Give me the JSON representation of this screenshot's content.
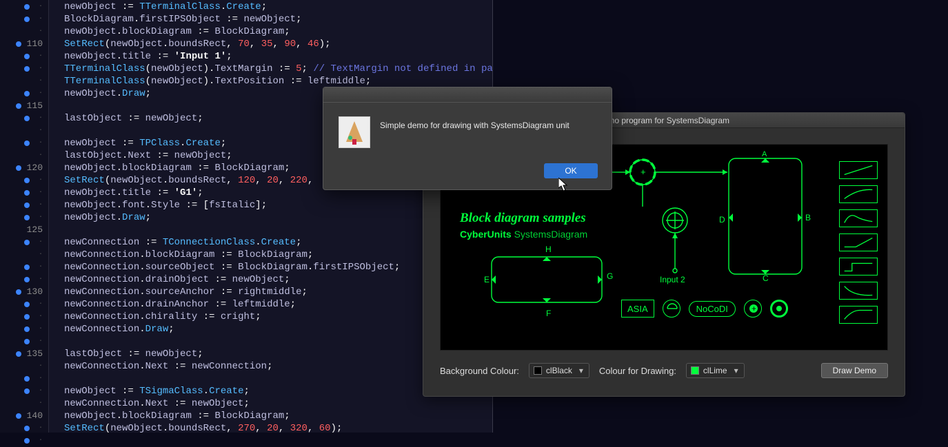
{
  "gutter": {
    "start": 107,
    "end": 142,
    "labeled": [
      110,
      115,
      120,
      125,
      130,
      135,
      140
    ],
    "breakpoints": [
      107,
      108,
      110,
      111,
      112,
      114,
      115,
      116,
      118,
      120,
      121,
      122,
      123,
      124,
      126,
      128,
      129,
      130,
      131,
      132,
      133,
      134,
      135,
      137,
      138,
      140,
      141,
      142
    ]
  },
  "code": {
    "lines": [
      [
        [
          "id",
          "newObject"
        ],
        [
          "punc",
          " := "
        ],
        [
          "type",
          "TTerminalClass"
        ],
        [
          "punc",
          "."
        ],
        [
          "func",
          "Create"
        ],
        [
          "punc",
          ";"
        ]
      ],
      [
        [
          "id",
          "BlockDiagram"
        ],
        [
          "punc",
          "."
        ],
        [
          "prop",
          "firstIPSObject"
        ],
        [
          "punc",
          " := "
        ],
        [
          "id",
          "newObject"
        ],
        [
          "punc",
          ";"
        ]
      ],
      [
        [
          "id",
          "newObject"
        ],
        [
          "punc",
          "."
        ],
        [
          "prop",
          "blockDiagram"
        ],
        [
          "punc",
          " := "
        ],
        [
          "id",
          "BlockDiagram"
        ],
        [
          "punc",
          ";"
        ]
      ],
      [
        [
          "func",
          "SetRect"
        ],
        [
          "punc",
          "("
        ],
        [
          "id",
          "newObject"
        ],
        [
          "punc",
          "."
        ],
        [
          "prop",
          "boundsRect"
        ],
        [
          "punc",
          ", "
        ],
        [
          "num",
          "70"
        ],
        [
          "punc",
          ", "
        ],
        [
          "num",
          "35"
        ],
        [
          "punc",
          ", "
        ],
        [
          "num",
          "90"
        ],
        [
          "punc",
          ", "
        ],
        [
          "num",
          "46"
        ],
        [
          "punc",
          ");"
        ]
      ],
      [
        [
          "id",
          "newObject"
        ],
        [
          "punc",
          "."
        ],
        [
          "prop",
          "title"
        ],
        [
          "punc",
          " := "
        ],
        [
          "str",
          "'Input 1'"
        ],
        [
          "punc",
          ";"
        ]
      ],
      [
        [
          "type",
          "TTerminalClass"
        ],
        [
          "punc",
          "("
        ],
        [
          "id",
          "newObject"
        ],
        [
          "punc",
          ")."
        ],
        [
          "prop",
          "TextMargin"
        ],
        [
          "punc",
          " := "
        ],
        [
          "num",
          "5"
        ],
        [
          "punc",
          "; "
        ],
        [
          "cmt",
          "// TextMargin not defined in parent class"
        ]
      ],
      [
        [
          "type",
          "TTerminalClass"
        ],
        [
          "punc",
          "("
        ],
        [
          "id",
          "newObject"
        ],
        [
          "punc",
          ")."
        ],
        [
          "prop",
          "TextPosition"
        ],
        [
          "punc",
          " := "
        ],
        [
          "const",
          "leftmiddle"
        ],
        [
          "punc",
          ";"
        ]
      ],
      [
        [
          "id",
          "newObject"
        ],
        [
          "punc",
          "."
        ],
        [
          "func",
          "Draw"
        ],
        [
          "punc",
          ";"
        ]
      ],
      [],
      [
        [
          "id",
          "lastObject"
        ],
        [
          "punc",
          " := "
        ],
        [
          "id",
          "newObject"
        ],
        [
          "punc",
          ";"
        ]
      ],
      [],
      [
        [
          "id",
          "newObject"
        ],
        [
          "punc",
          " := "
        ],
        [
          "type",
          "TPClass"
        ],
        [
          "punc",
          "."
        ],
        [
          "func",
          "Create"
        ],
        [
          "punc",
          ";"
        ]
      ],
      [
        [
          "id",
          "lastObject"
        ],
        [
          "punc",
          "."
        ],
        [
          "prop",
          "Next"
        ],
        [
          "punc",
          " := "
        ],
        [
          "id",
          "newObject"
        ],
        [
          "punc",
          ";"
        ]
      ],
      [
        [
          "id",
          "newObject"
        ],
        [
          "punc",
          "."
        ],
        [
          "prop",
          "blockDiagram"
        ],
        [
          "punc",
          " := "
        ],
        [
          "id",
          "BlockDiagram"
        ],
        [
          "punc",
          ";"
        ]
      ],
      [
        [
          "func",
          "SetRect"
        ],
        [
          "punc",
          "("
        ],
        [
          "id",
          "newObject"
        ],
        [
          "punc",
          "."
        ],
        [
          "prop",
          "boundsRect"
        ],
        [
          "punc",
          ", "
        ],
        [
          "num",
          "120"
        ],
        [
          "punc",
          ", "
        ],
        [
          "num",
          "20"
        ],
        [
          "punc",
          ", "
        ],
        [
          "num",
          "220"
        ],
        [
          "punc",
          ","
        ]
      ],
      [
        [
          "id",
          "newObject"
        ],
        [
          "punc",
          "."
        ],
        [
          "prop",
          "title"
        ],
        [
          "punc",
          " := "
        ],
        [
          "str",
          "'G1'"
        ],
        [
          "punc",
          ";"
        ]
      ],
      [
        [
          "id",
          "newObject"
        ],
        [
          "punc",
          "."
        ],
        [
          "prop",
          "font"
        ],
        [
          "punc",
          "."
        ],
        [
          "prop",
          "Style"
        ],
        [
          "punc",
          " := ["
        ],
        [
          "const",
          "fsItalic"
        ],
        [
          "punc",
          "];"
        ]
      ],
      [
        [
          "id",
          "newObject"
        ],
        [
          "punc",
          "."
        ],
        [
          "func",
          "Draw"
        ],
        [
          "punc",
          ";"
        ]
      ],
      [],
      [
        [
          "id",
          "newConnection"
        ],
        [
          "punc",
          " := "
        ],
        [
          "type",
          "TConnectionClass"
        ],
        [
          "punc",
          "."
        ],
        [
          "func",
          "Create"
        ],
        [
          "punc",
          ";"
        ]
      ],
      [
        [
          "id",
          "newConnection"
        ],
        [
          "punc",
          "."
        ],
        [
          "prop",
          "blockDiagram"
        ],
        [
          "punc",
          " := "
        ],
        [
          "id",
          "BlockDiagram"
        ],
        [
          "punc",
          ";"
        ]
      ],
      [
        [
          "id",
          "newConnection"
        ],
        [
          "punc",
          "."
        ],
        [
          "prop",
          "sourceObject"
        ],
        [
          "punc",
          " := "
        ],
        [
          "id",
          "BlockDiagram"
        ],
        [
          "punc",
          "."
        ],
        [
          "prop",
          "firstIPSObject"
        ],
        [
          "punc",
          ";"
        ]
      ],
      [
        [
          "id",
          "newConnection"
        ],
        [
          "punc",
          "."
        ],
        [
          "prop",
          "drainObject"
        ],
        [
          "punc",
          " := "
        ],
        [
          "id",
          "newObject"
        ],
        [
          "punc",
          ";"
        ]
      ],
      [
        [
          "id",
          "newConnection"
        ],
        [
          "punc",
          "."
        ],
        [
          "prop",
          "sourceAnchor"
        ],
        [
          "punc",
          " := "
        ],
        [
          "const",
          "rightmiddle"
        ],
        [
          "punc",
          ";"
        ]
      ],
      [
        [
          "id",
          "newConnection"
        ],
        [
          "punc",
          "."
        ],
        [
          "prop",
          "drainAnchor"
        ],
        [
          "punc",
          " := "
        ],
        [
          "const",
          "leftmiddle"
        ],
        [
          "punc",
          ";"
        ]
      ],
      [
        [
          "id",
          "newConnection"
        ],
        [
          "punc",
          "."
        ],
        [
          "prop",
          "chirality"
        ],
        [
          "punc",
          " := "
        ],
        [
          "const",
          "cright"
        ],
        [
          "punc",
          ";"
        ]
      ],
      [
        [
          "id",
          "newConnection"
        ],
        [
          "punc",
          "."
        ],
        [
          "func",
          "Draw"
        ],
        [
          "punc",
          ";"
        ]
      ],
      [],
      [
        [
          "id",
          "lastObject"
        ],
        [
          "punc",
          " := "
        ],
        [
          "id",
          "newObject"
        ],
        [
          "punc",
          ";"
        ]
      ],
      [
        [
          "id",
          "newConnection"
        ],
        [
          "punc",
          "."
        ],
        [
          "prop",
          "Next"
        ],
        [
          "punc",
          " := "
        ],
        [
          "id",
          "newConnection"
        ],
        [
          "punc",
          ";"
        ]
      ],
      [],
      [
        [
          "id",
          "newObject"
        ],
        [
          "punc",
          " := "
        ],
        [
          "type",
          "TSigmaClass"
        ],
        [
          "punc",
          "."
        ],
        [
          "func",
          "Create"
        ],
        [
          "punc",
          ";"
        ]
      ],
      [
        [
          "id",
          "newConnection"
        ],
        [
          "punc",
          "."
        ],
        [
          "prop",
          "Next"
        ],
        [
          "punc",
          " := "
        ],
        [
          "id",
          "newObject"
        ],
        [
          "punc",
          ";"
        ]
      ],
      [
        [
          "id",
          "newObject"
        ],
        [
          "punc",
          "."
        ],
        [
          "prop",
          "blockDiagram"
        ],
        [
          "punc",
          " := "
        ],
        [
          "id",
          "BlockDiagram"
        ],
        [
          "punc",
          ";"
        ]
      ],
      [
        [
          "func",
          "SetRect"
        ],
        [
          "punc",
          "("
        ],
        [
          "id",
          "newObject"
        ],
        [
          "punc",
          "."
        ],
        [
          "prop",
          "boundsRect"
        ],
        [
          "punc",
          ", "
        ],
        [
          "num",
          "270"
        ],
        [
          "punc",
          ", "
        ],
        [
          "num",
          "20"
        ],
        [
          "punc",
          ", "
        ],
        [
          "num",
          "320"
        ],
        [
          "punc",
          ", "
        ],
        [
          "num",
          "60"
        ],
        [
          "punc",
          ");"
        ]
      ]
    ]
  },
  "dialog": {
    "message": "Simple demo for drawing with SystemsDiagram unit",
    "ok": "OK"
  },
  "demowin": {
    "title": "demo program for SystemsDiagram",
    "canvas": {
      "title": "Block diagram samples",
      "sub_bold": "CyberUnits",
      "sub_rest": " SystemsDiagram",
      "labels": {
        "E": "E",
        "F": "F",
        "G": "G",
        "H": "H",
        "A": "A",
        "B": "B",
        "C": "C",
        "D": "D",
        "input2": "Input 2"
      },
      "buttons": {
        "asia": "ASIA",
        "nocodi": "NoCoDI"
      }
    },
    "bottom": {
      "bg_label": "Background Colour:",
      "bg_value": "clBlack",
      "fg_label": "Colour for Drawing:",
      "fg_value": "clLime",
      "draw": "Draw Demo"
    }
  }
}
